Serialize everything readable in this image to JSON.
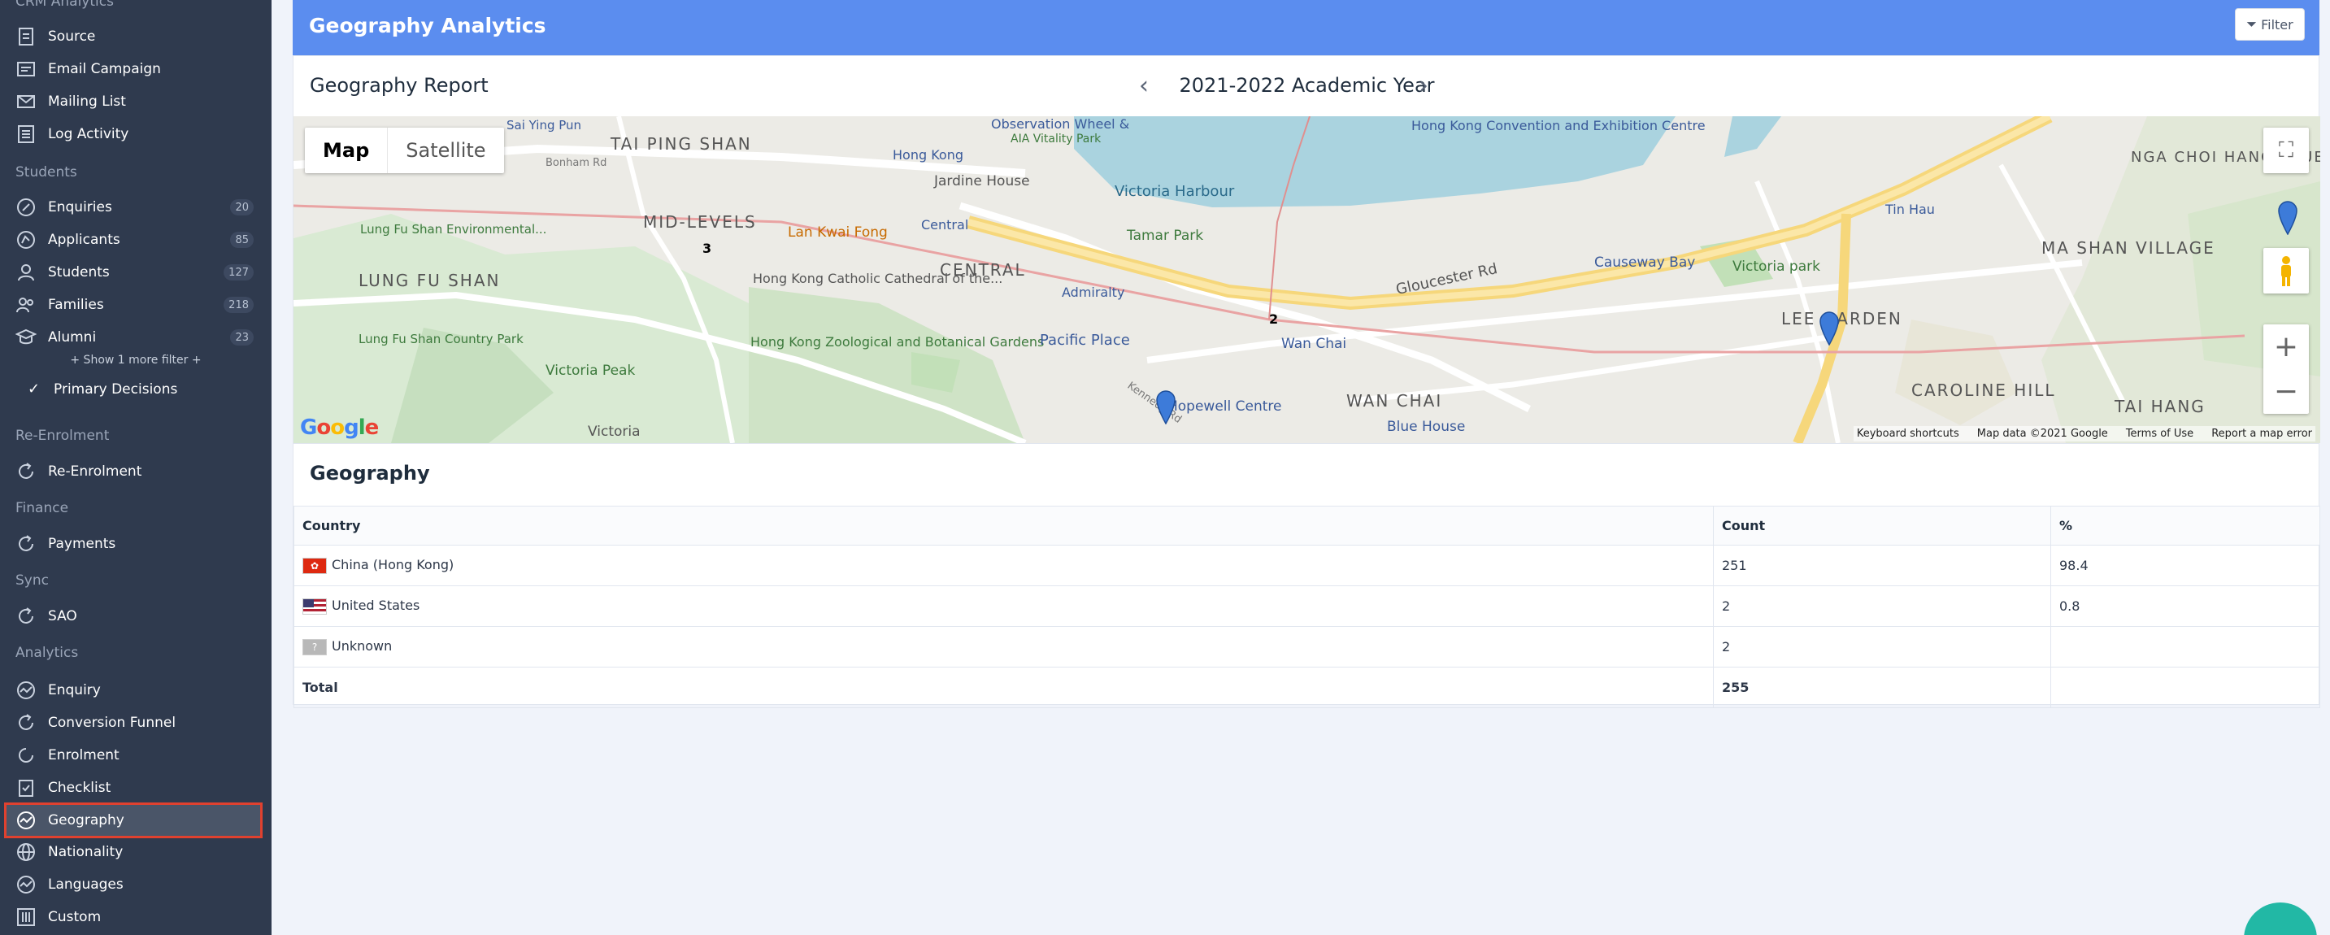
{
  "sidebar": {
    "app_heading": "CRM Analytics",
    "top_items": [
      {
        "label": "Source",
        "icon": "source-icon"
      },
      {
        "label": "Email Campaign",
        "icon": "email-campaign-icon"
      },
      {
        "label": "Mailing List",
        "icon": "mailing-list-icon"
      },
      {
        "label": "Log Activity",
        "icon": "log-activity-icon"
      }
    ],
    "students_heading": "Students",
    "student_items": [
      {
        "label": "Enquiries",
        "count": "20",
        "icon": "enquiries-icon"
      },
      {
        "label": "Applicants",
        "count": "85",
        "icon": "applicants-icon"
      },
      {
        "label": "Students",
        "count": "127",
        "icon": "students-icon"
      },
      {
        "label": "Families",
        "count": "218",
        "icon": "families-icon"
      },
      {
        "label": "Alumni",
        "count": "23",
        "icon": "alumni-icon"
      }
    ],
    "show_more": "+ Show 1 more filter +",
    "primary_decisions": "Primary Decisions",
    "reenrolment_heading": "Re-Enrolment",
    "reenrolment_item": "Re-Enrolment",
    "finance_heading": "Finance",
    "payments_item": "Payments",
    "sync_heading": "Sync",
    "sao_item": "SAO",
    "analytics_heading": "Analytics",
    "analytics_items": [
      {
        "label": "Enquiry",
        "icon": "enquiry-chart-icon"
      },
      {
        "label": "Conversion Funnel",
        "icon": "conversion-funnel-icon"
      },
      {
        "label": "Enrolment",
        "icon": "enrolment-icon"
      },
      {
        "label": "Checklist",
        "icon": "checklist-icon"
      },
      {
        "label": "Geography",
        "icon": "geography-icon",
        "active": true
      },
      {
        "label": "Nationality",
        "icon": "globe-icon"
      },
      {
        "label": "Languages",
        "icon": "languages-icon"
      },
      {
        "label": "Custom",
        "icon": "custom-icon"
      }
    ]
  },
  "header": {
    "title": "Geography Analytics",
    "filter_label": "Filter"
  },
  "report": {
    "title": "Geography Report",
    "year": "2021-2022 Academic Year",
    "prev": "‹",
    "next": "›"
  },
  "map": {
    "type_map": "Map",
    "type_satellite": "Satellite",
    "footer": {
      "shortcuts": "Keyboard shortcuts",
      "data": "Map data ©2021 Google",
      "terms": "Terms of Use",
      "report": "Report a map error"
    },
    "google": "Google",
    "labels": {
      "sai_ying_pun": "Sai Ying Pun",
      "tai_ping_shan": "TAI PING SHAN",
      "mid_levels": "MID-LEVELS",
      "lung_fu_shan": "LUNG FU SHAN",
      "lung_fu_shan_env": "Lung Fu Shan Environmental...",
      "lung_fu_shan_park": "Lung Fu Shan Country Park",
      "victoria_peak": "Victoria Peak",
      "victoria": "Victoria",
      "lan_kwai_fong": "Lan Kwai Fong",
      "central": "CENTRAL",
      "central_station": "Central",
      "hk_cathedral": "Hong Kong Catholic Cathedral of the...",
      "hk_zoo": "Hong Kong Zoological and Botanical Gardens",
      "jardine": "Jardine House",
      "hong_kong": "Hong Kong",
      "observation": "Observation Wheel &",
      "aia": "AIA Vitality Park",
      "victoria_harbour": "Victoria Harbour",
      "tamar_park": "Tamar Park",
      "admiralty": "Admiralty",
      "pacific_place": "Pacific Place",
      "hkcec": "Hong Kong Convention and Exhibition Centre",
      "wan_chai": "Wan Chai",
      "wan_chai_district": "WAN CHAI",
      "hopewell": "Hopewell Centre",
      "blue_house": "Blue House",
      "gloucester": "Gloucester Rd",
      "causeway_bay": "Causeway Bay",
      "lee_garden": "LEE GARDEN",
      "caroline_hill": "CAROLINE HILL",
      "tai_hang": "TAI HANG",
      "tin_hau": "Tin Hau",
      "victoria_park": "Victoria park",
      "ma_shan_village": "MA SHAN VILLAGE",
      "nga_choi_hang": "NGA CHOI HANG TSUEN",
      "kennedy_rd": "Kennedy Rd",
      "bonham_rd": "Bonham Rd",
      "cluster_2": "2",
      "cluster_3": "3"
    }
  },
  "geography": {
    "title": "Geography",
    "headers": {
      "country": "Country",
      "count": "Count",
      "pct": "%"
    },
    "rows": [
      {
        "country": "China (Hong Kong)",
        "count": "251",
        "pct": "98.4",
        "flag": "hk-flag-icon"
      },
      {
        "country": "United States",
        "count": "2",
        "pct": "0.8",
        "flag": "us-flag-icon"
      },
      {
        "country": "Unknown",
        "count": "2",
        "pct": "",
        "flag": "unknown-flag-icon"
      }
    ],
    "total_label": "Total",
    "total_count": "255"
  }
}
